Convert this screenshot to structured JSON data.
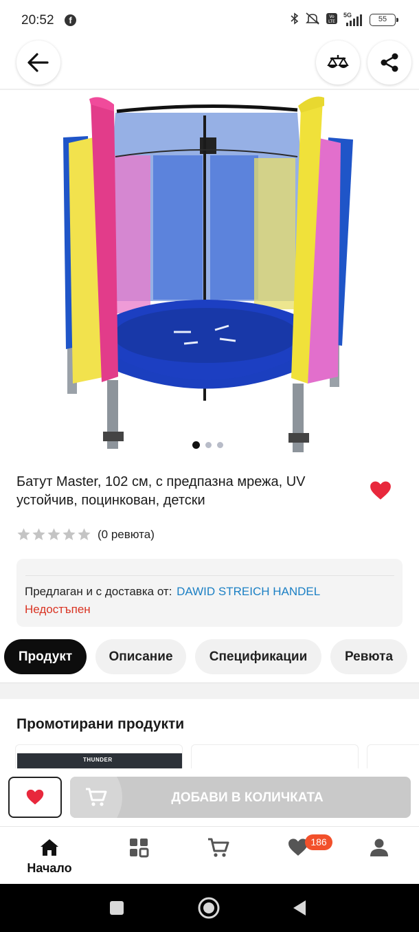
{
  "status_bar": {
    "time": "20:52",
    "facebook_glyph": "f",
    "network_label": "5G",
    "battery": "55",
    "icons": [
      "facebook-icon",
      "bluetooth-icon",
      "mute-icon",
      "volte-icon",
      "signal-icon",
      "battery-icon"
    ]
  },
  "header": {
    "back_icon": "arrow-left-icon",
    "compare_icon": "scale-icon",
    "share_icon": "share-icon"
  },
  "product": {
    "title": "Батут Master, 102 см, с предпазна мрежа, UV устойчив, поцинкован, детски",
    "favorite_icon": "heart-icon",
    "rating_stars": 0,
    "rating_max": 5,
    "review_count": "(0 ревюта)",
    "image_count": 3,
    "active_image": 1
  },
  "seller": {
    "label": "Предлаган и с доставка от:",
    "name": "DAWID STREICH HANDEL",
    "availability": "Недостъпен"
  },
  "tabs": [
    {
      "label": "Продукт",
      "active": true
    },
    {
      "label": "Описание",
      "active": false
    },
    {
      "label": "Спецификации",
      "active": false
    },
    {
      "label": "Ревюта",
      "active": false
    }
  ],
  "promoted": {
    "title": "Промотирани продукти",
    "card_brand": "THUNDER"
  },
  "actions": {
    "add_to_cart": "ДОБАВИ В КОЛИЧКАТА"
  },
  "bottom_nav": {
    "home": "Начало",
    "favorites_badge": "186",
    "items": [
      "home-icon",
      "categories-icon",
      "cart-icon",
      "heart-icon",
      "profile-icon"
    ]
  },
  "colors": {
    "accent_red": "#e8283c",
    "link_blue": "#1a7fc4",
    "status_red": "#d93322",
    "badge_orange": "#f2502b",
    "button_disabled": "#c9c9c9"
  }
}
